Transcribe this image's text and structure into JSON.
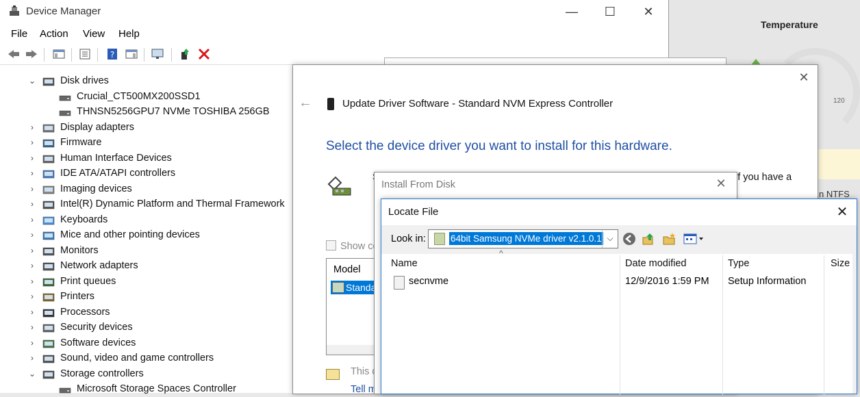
{
  "device_manager": {
    "title": "Device Manager",
    "window_buttons": {
      "minimize": "—",
      "maximize": "☐",
      "close": "✕"
    },
    "menu": [
      "File",
      "Action",
      "View",
      "Help"
    ],
    "tree": [
      {
        "label": "Disk drives",
        "expanded": true,
        "level": 0
      },
      {
        "label": "Crucial_CT500MX200SSD1",
        "level": 1
      },
      {
        "label": "THNSN5256GPU7 NVMe TOSHIBA 256GB",
        "level": 1
      },
      {
        "label": "Display adapters",
        "level": 0
      },
      {
        "label": "Firmware",
        "level": 0
      },
      {
        "label": "Human Interface Devices",
        "level": 0
      },
      {
        "label": "IDE ATA/ATAPI controllers",
        "level": 0
      },
      {
        "label": "Imaging devices",
        "level": 0
      },
      {
        "label": "Intel(R) Dynamic Platform and Thermal Framework",
        "level": 0
      },
      {
        "label": "Keyboards",
        "level": 0
      },
      {
        "label": "Mice and other pointing devices",
        "level": 0
      },
      {
        "label": "Monitors",
        "level": 0
      },
      {
        "label": "Network adapters",
        "level": 0
      },
      {
        "label": "Print queues",
        "level": 0
      },
      {
        "label": "Printers",
        "level": 0
      },
      {
        "label": "Processors",
        "level": 0
      },
      {
        "label": "Security devices",
        "level": 0
      },
      {
        "label": "Software devices",
        "level": 0
      },
      {
        "label": "Sound, video and game controllers",
        "level": 0
      },
      {
        "label": "Storage controllers",
        "expanded": true,
        "level": 0
      },
      {
        "label": "Microsoft Storage Spaces Controller",
        "level": 1
      }
    ]
  },
  "background_app": {
    "title": "Temperature",
    "gauge_label": "120",
    "partial_text": "n NTFS"
  },
  "update_driver": {
    "title": "Update Driver Software - Standard NVM Express Controller",
    "heading": "Select the device driver you want to install for this hardware.",
    "desc_start": "S",
    "desc_end": "if you have a",
    "show_compat": "Show co",
    "model_header": "Model",
    "model_item": "Standa",
    "signed_text": "This dr",
    "tell_me": "Tell me"
  },
  "install_from_disk": {
    "title": "Install From Disk"
  },
  "locate_file": {
    "title": "Locate File",
    "look_in_label": "Look in:",
    "look_in_value": "64bit Samsung NVMe driver v2.1.0.1",
    "columns": [
      "Name",
      "Date modified",
      "Type",
      "Size"
    ],
    "files": [
      {
        "name": "secnvme",
        "date": "12/9/2016 1:59 PM",
        "type": "Setup Information"
      }
    ]
  },
  "colors": {
    "accent": "#0078d7",
    "heading_blue": "#1f4fa3",
    "delete_red": "#d9161c"
  }
}
